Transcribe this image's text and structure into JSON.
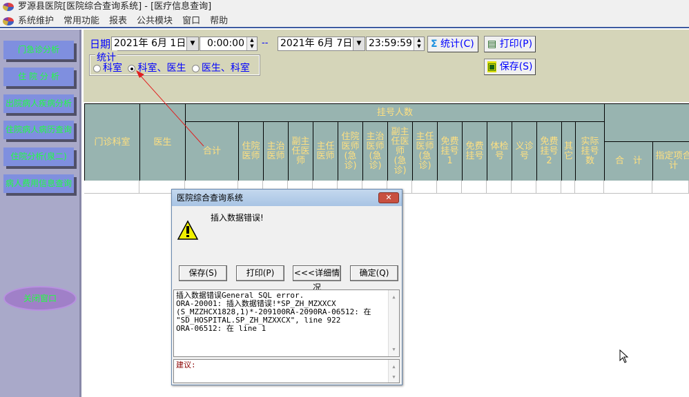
{
  "window": {
    "title": "罗源县医院[医院综合查询系统] - [医疗信息查询]"
  },
  "menu": [
    "系统维护",
    "常用功能",
    "报表",
    "公共模块",
    "窗口",
    "帮助"
  ],
  "sidebar": {
    "items": [
      "门急诊分析",
      "住 院 分 析",
      "出院病人疾病分析",
      "住院病人病历查询",
      "住院分析(泉二)",
      "病人费用信息查询"
    ],
    "close": "关闭窗口"
  },
  "filter": {
    "date_label": "日期",
    "start_date": "2021年 6月 1日",
    "start_time": "0:00:00",
    "separator": "--",
    "end_date": "2021年 6月 7日",
    "end_time": "23:59:59",
    "stat_button": "统计(C)",
    "print_button": "打印(P)",
    "save_button": "保存(S)",
    "group_label": "统计",
    "options": [
      "科室",
      "科室、医生",
      "医生、科室"
    ],
    "selected": "科室、医生"
  },
  "grid": {
    "col_dept": "门诊科室",
    "col_doctor": "医生",
    "group": "挂号人数",
    "sub": [
      "合计",
      "住院医师",
      "主治医师",
      "副主任医师",
      "主任医师",
      "住院医师(急诊)",
      "主治医师(急诊)",
      "副主任医师(急诊)",
      "主任医师(急诊)",
      "免费挂号1",
      "免费挂号",
      "体检号",
      "义诊号",
      "免费挂号2",
      "其它",
      "实际挂号数"
    ],
    "right_sub": [
      "合　计",
      "指定项合计"
    ]
  },
  "dialog": {
    "title": "医院综合查询系统",
    "message": "插入数据错误!",
    "buttons": [
      "保存(S)",
      "打印(P)",
      "<<<详细情况",
      "确定(Q)"
    ],
    "detail": "插入数据错误General SQL error.\nORA-20001: 插入数据错误!*SP_ZH_MZXXCX\n(S_MZZHCX1828,1)*-209100RA-2090RA-06512: 在\n\"SD_HOSPITAL.SP_ZH_MZXXCX\", line 922\nORA-06512: 在 line 1",
    "suggestion": "建议:"
  },
  "colors": {
    "header_bg": "#98b4b0",
    "header_text": "#ffe080",
    "sidebar_text": "#20ff40",
    "panel_bg": "#d5d5b9"
  }
}
